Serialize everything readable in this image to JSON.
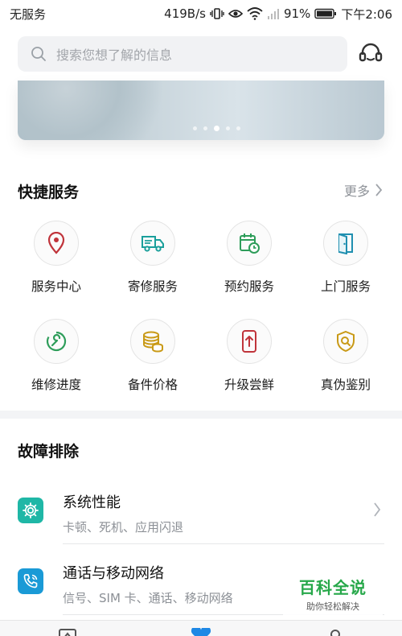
{
  "status_bar": {
    "carrier": "无服务",
    "speed": "419B/s",
    "battery": "91%",
    "time": "下午2:06"
  },
  "search": {
    "placeholder": "搜索您想了解的信息"
  },
  "banner": {
    "dots_count": 5,
    "active_index": 2
  },
  "quick_services": {
    "title": "快捷服务",
    "more_label": "更多",
    "items": [
      {
        "label": "服务中心",
        "icon": "location-pin-icon",
        "color": "#c0343b"
      },
      {
        "label": "寄修服务",
        "icon": "delivery-truck-icon",
        "color": "#1a9f9b"
      },
      {
        "label": "预约服务",
        "icon": "calendar-clock-icon",
        "color": "#2e9d5a"
      },
      {
        "label": "上门服务",
        "icon": "door-icon",
        "color": "#1f8fb0"
      },
      {
        "label": "维修进度",
        "icon": "wrench-progress-icon",
        "color": "#2e9d5a"
      },
      {
        "label": "备件价格",
        "icon": "coins-icon",
        "color": "#c99a17"
      },
      {
        "label": "升级尝鲜",
        "icon": "phone-upgrade-icon",
        "color": "#c0343b"
      },
      {
        "label": "真伪鉴别",
        "icon": "shield-search-icon",
        "color": "#c99a17"
      }
    ]
  },
  "troubleshooting": {
    "title": "故障排除",
    "items": [
      {
        "title": "系统性能",
        "subtitle": "卡顿、死机、应用闪退",
        "icon": "gear-icon",
        "color": "#1fb7a6"
      },
      {
        "title": "通话与移动网络",
        "subtitle": "信号、SIM 卡、通话、移动网络",
        "icon": "phone-call-icon",
        "color": "#1a9ad6"
      }
    ]
  },
  "watermark": {
    "title": "百科全说",
    "subtitle": "助你轻松解决"
  }
}
